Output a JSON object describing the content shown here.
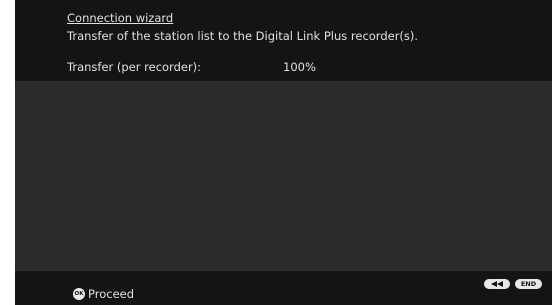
{
  "header": {
    "title": "Connection wizard",
    "subtitle": "Transfer of the station list to the Digital Link Plus recorder(s).",
    "transfer_label": "Transfer (per recorder):",
    "transfer_value": "100%"
  },
  "footer": {
    "rewind_icon": "rewind-icon",
    "end_label": "END",
    "ok_icon_label": "OK",
    "proceed_label": "Proceed"
  },
  "colors": {
    "header_bg": "#141414",
    "body_bg": "#2b2b2b",
    "text": "#e0e0e0",
    "button_bg": "#e8e8e8"
  }
}
